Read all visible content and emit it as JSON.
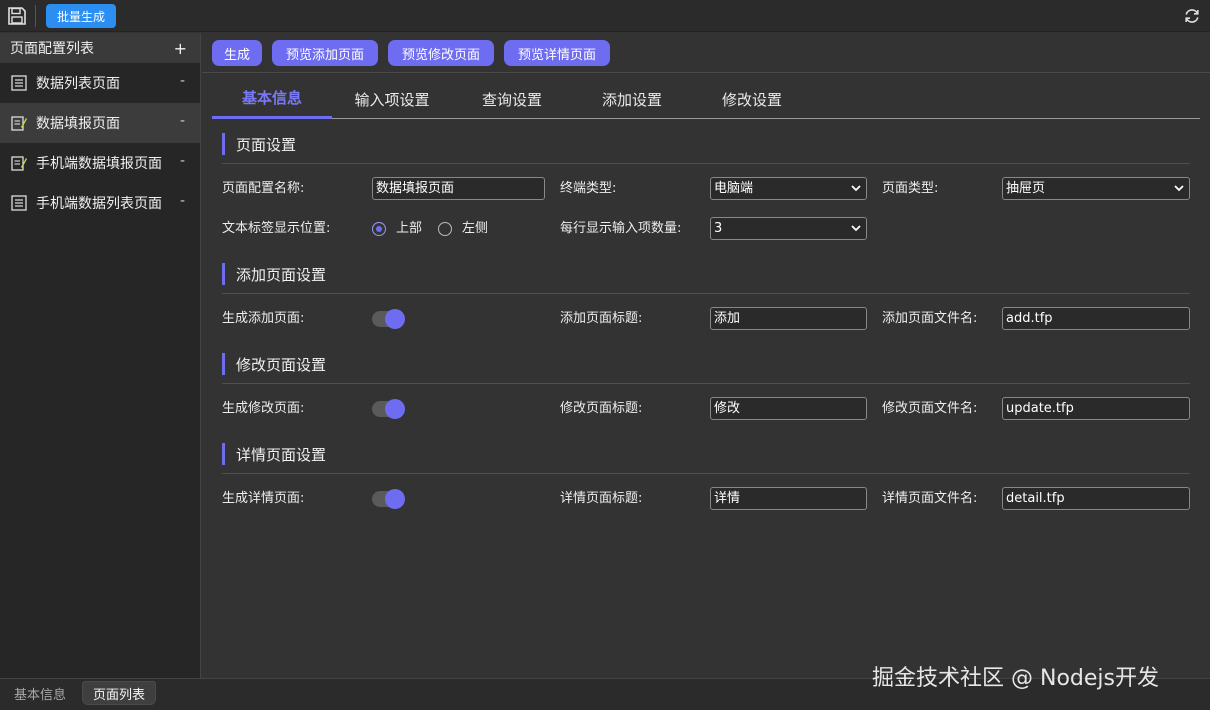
{
  "toolbar": {
    "batch_generate_label": "批量生成",
    "icons": {
      "save": "save-icon",
      "refresh": "refresh-icon"
    }
  },
  "sidebar": {
    "header_title": "页面配置列表",
    "add_symbol": "+",
    "items": [
      {
        "label": "数据列表页面",
        "icon": "list-page-icon",
        "action": "-",
        "selected": false
      },
      {
        "label": "数据填报页面",
        "icon": "form-page-icon",
        "action": "-",
        "selected": true
      },
      {
        "label": "手机端数据填报页面",
        "icon": "form-page-icon",
        "action": "-",
        "selected": false
      },
      {
        "label": "手机端数据列表页面",
        "icon": "list-page-icon",
        "action": "-",
        "selected": false
      }
    ]
  },
  "bottom_tabs": [
    {
      "label": "基本信息",
      "active": false
    },
    {
      "label": "页面列表",
      "active": true
    }
  ],
  "actions": {
    "generate": "生成",
    "preview_add": "预览添加页面",
    "preview_update": "预览修改页面",
    "preview_detail": "预览详情页面"
  },
  "tabs": [
    {
      "label": "基本信息",
      "active": true
    },
    {
      "label": "输入项设置",
      "active": false
    },
    {
      "label": "查询设置",
      "active": false
    },
    {
      "label": "添加设置",
      "active": false
    },
    {
      "label": "修改设置",
      "active": false
    }
  ],
  "page_settings": {
    "title": "页面设置",
    "config_name_label": "页面配置名称:",
    "config_name_value": "数据填报页面",
    "terminal_type_label": "终端类型:",
    "terminal_type_value": "电脑端",
    "page_type_label": "页面类型:",
    "page_type_value": "抽屉页",
    "label_position_label": "文本标签显示位置:",
    "label_position_options": [
      {
        "label": "上部",
        "checked": true
      },
      {
        "label": "左侧",
        "checked": false
      }
    ],
    "per_row_label": "每行显示输入项数量:",
    "per_row_value": "3"
  },
  "add_settings": {
    "title": "添加页面设置",
    "generate_label": "生成添加页面:",
    "generate_on": true,
    "page_title_label": "添加页面标题:",
    "page_title_value": "添加",
    "file_name_label": "添加页面文件名:",
    "file_name_value": "add.tfp"
  },
  "update_settings": {
    "title": "修改页面设置",
    "generate_label": "生成修改页面:",
    "generate_on": true,
    "page_title_label": "修改页面标题:",
    "page_title_value": "修改",
    "file_name_label": "修改页面文件名:",
    "file_name_value": "update.tfp"
  },
  "detail_settings": {
    "title": "详情页面设置",
    "generate_label": "生成详情页面:",
    "generate_on": true,
    "page_title_label": "详情页面标题:",
    "page_title_value": "详情",
    "file_name_label": "详情页面文件名:",
    "file_name_value": "detail.tfp"
  },
  "watermark": "掘金技术社区 @ Nodejs开发",
  "colors": {
    "accent": "#6e6cf0",
    "batch_button": "#2b8ef0",
    "background": "#333333",
    "sidebar_bg": "#262626"
  }
}
